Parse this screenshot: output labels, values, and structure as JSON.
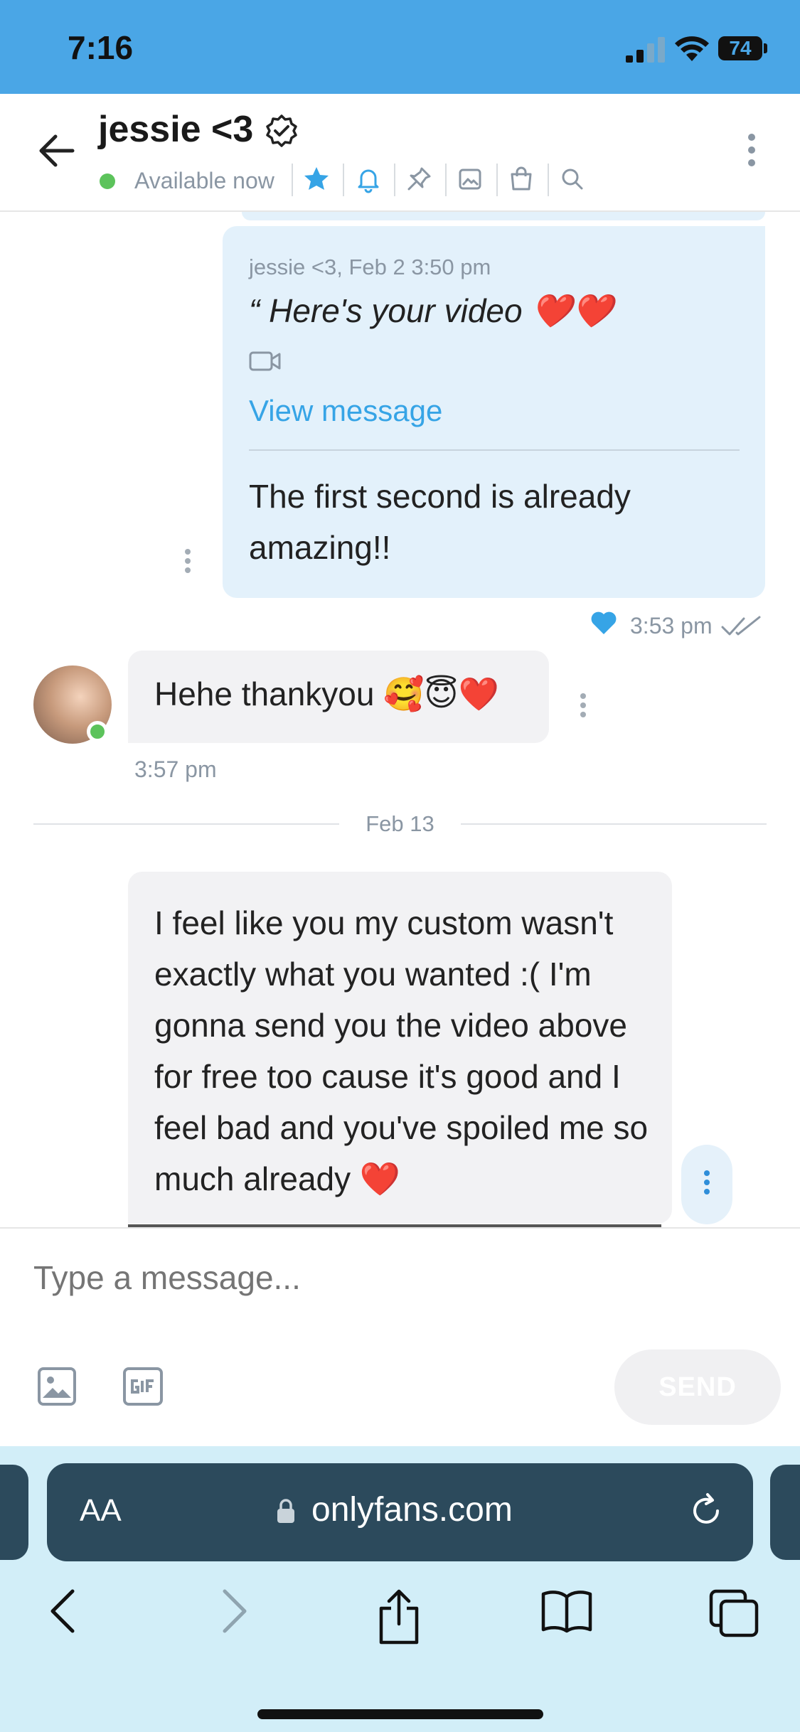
{
  "status_bar": {
    "time": "7:16",
    "battery": "74"
  },
  "header": {
    "name": "jessie <3",
    "presence": "Available now"
  },
  "messages": {
    "outgoing": {
      "quote_meta": "jessie <3, Feb 2 3:50 pm",
      "quote_text": "“ Here's your video ❤️❤️",
      "view_message": "View message",
      "text": "The first second is already amazing!!",
      "time": "3:53 pm"
    },
    "incoming_1": {
      "text": "Hehe thankyou 🥰😇❤️",
      "time": "3:57 pm"
    },
    "day_separator": "Feb 13",
    "incoming_2": {
      "text": "I feel like you my custom wasn't exactly what you wanted :( I'm gonna send you the video above for free too cause it's good and I feel bad and you've spoiled me so much already ❤️"
    }
  },
  "composer": {
    "placeholder": "Type a message...",
    "send_label": "SEND"
  },
  "browser": {
    "aa_label": "AA",
    "url": "onlyfans.com"
  },
  "colors": {
    "status_bar": "#4aa6e6",
    "accent": "#36a4e6",
    "outgoing_bubble": "#e3f1fb",
    "incoming_bubble": "#f2f2f4",
    "online": "#5cc35b",
    "url_bar": "#2c4a5c"
  },
  "icons": {
    "header_toolbar": [
      "star-icon",
      "bell-icon",
      "pin-icon",
      "image-icon",
      "bag-icon",
      "search-icon"
    ],
    "browser_nav": [
      "back-chevron-icon",
      "forward-chevron-icon",
      "share-icon",
      "bookmarks-icon",
      "tabs-icon"
    ]
  }
}
